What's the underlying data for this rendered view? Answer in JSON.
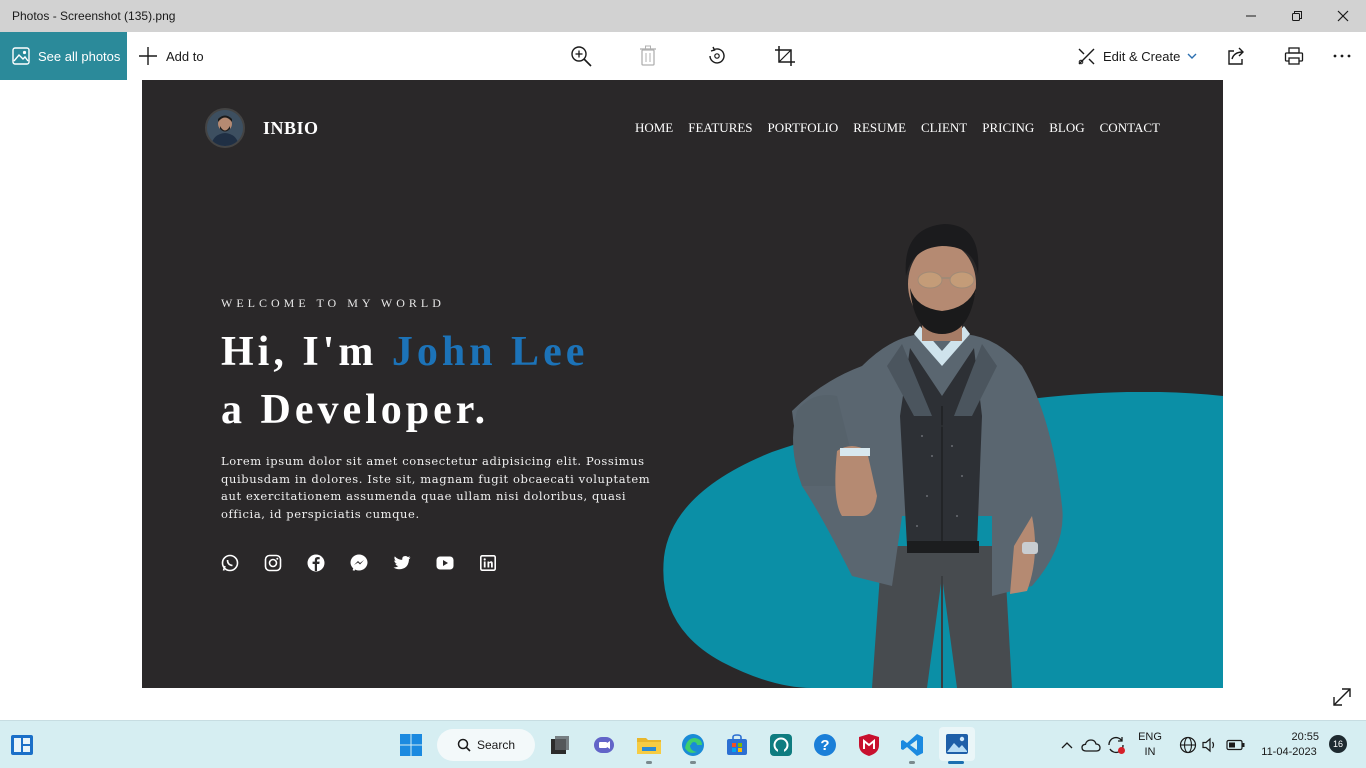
{
  "window": {
    "title": "Photos - Screenshot (135).png"
  },
  "toolbar": {
    "see_all_label": "See all photos",
    "add_to_label": "Add to",
    "edit_create_label": "Edit & Create",
    "accent": "#2b8a9a"
  },
  "site": {
    "brand": "INBIO",
    "nav": [
      "HOME",
      "FEATURES",
      "PORTFOLIO",
      "RESUME",
      "CLIENT",
      "PRICING",
      "BLOG",
      "CONTACT"
    ],
    "welcome": "WELCOME TO MY WORLD",
    "hero_prefix": "Hi, I'm ",
    "hero_name": "John Lee",
    "hero_line2": "a Developer.",
    "description": "Lorem ipsum dolor sit amet consectetur adipisicing elit. Possimus quibusdam in dolores. Iste sit, magnam fugit obcaecati voluptatem aut exercitationem assumenda quae ullam nisi doloribus, quasi officia, id perspiciatis cumque.",
    "socials": [
      "whatsapp-icon",
      "instagram-icon",
      "facebook-icon",
      "messenger-icon",
      "twitter-icon",
      "youtube-icon",
      "linkedin-icon"
    ],
    "bg_color": "#2a2829",
    "accent_name_color": "#1c73b8",
    "blob_color": "#0b8fa6"
  },
  "taskbar": {
    "search_label": "Search",
    "lang_line1": "ENG",
    "lang_line2": "IN",
    "time": "20:55",
    "date": "11-04-2023",
    "notification_count": "16"
  }
}
